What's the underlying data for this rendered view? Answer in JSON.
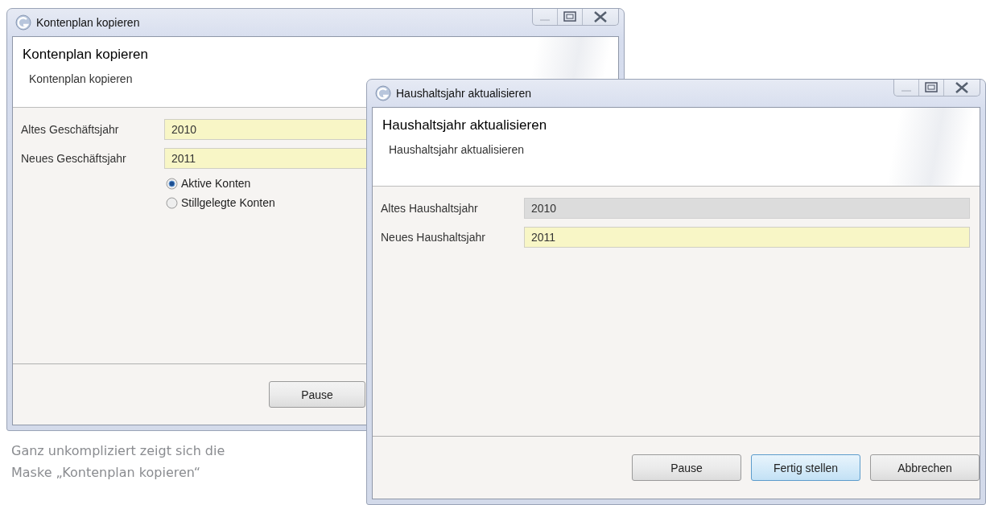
{
  "windows": [
    {
      "title": "Kontenplan kopieren",
      "header": {
        "title": "Kontenplan kopieren",
        "subtitle": "Kontenplan kopieren"
      },
      "fields": [
        {
          "label": "Altes Geschäftsjahr",
          "value": "2010",
          "disabled": false
        },
        {
          "label": "Neues Geschäftsjahr",
          "value": "2011",
          "disabled": false
        }
      ],
      "options": [
        {
          "label": "Aktive Konten",
          "selected": true
        },
        {
          "label": "Stillgelegte Konten",
          "selected": false
        }
      ],
      "buttons": [
        {
          "label": "Pause",
          "default": false
        }
      ]
    },
    {
      "title": "Haushaltsjahr aktualisieren",
      "header": {
        "title": "Haushaltsjahr aktualisieren",
        "subtitle": "Haushaltsjahr aktualisieren"
      },
      "fields": [
        {
          "label": "Altes Haushaltsjahr",
          "value": "2010",
          "disabled": true
        },
        {
          "label": "Neues Haushaltsjahr",
          "value": "2011",
          "disabled": false
        }
      ],
      "buttons": [
        {
          "label": "Pause",
          "default": false
        },
        {
          "label": "Fertig stellen",
          "default": true
        },
        {
          "label": "Abbrechen",
          "default": false
        }
      ]
    }
  ],
  "caption": "Ganz unkompliziert zeigt sich die Maske „Kontenplan kopieren“"
}
